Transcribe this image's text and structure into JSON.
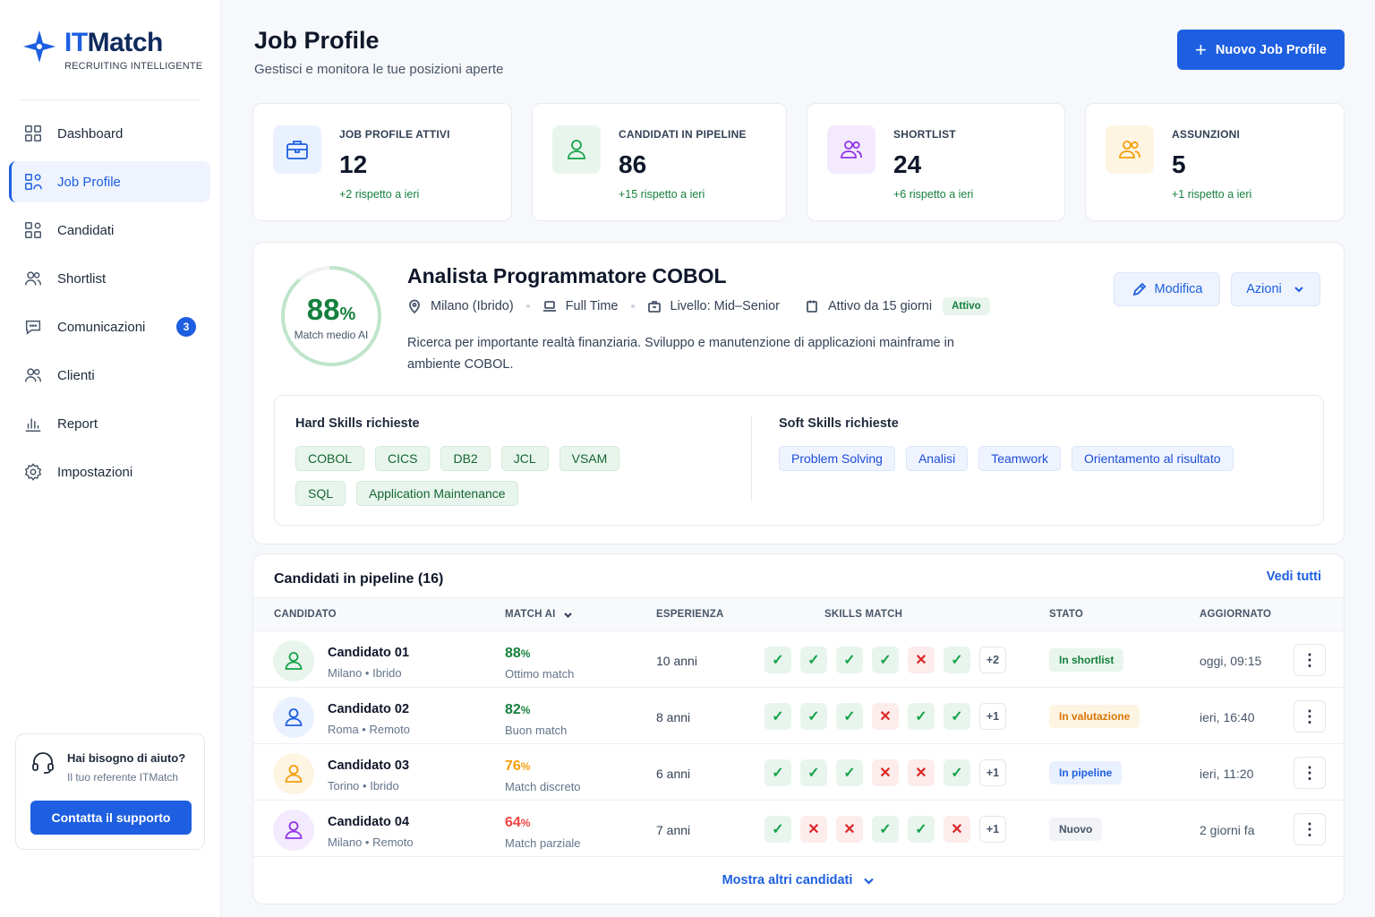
{
  "brand": {
    "name_prefix": "IT",
    "name_suffix": "Match",
    "tagline": "RECRUITING INTELLIGENTE",
    "color": "#1d5fe0"
  },
  "sidebar": {
    "items": [
      {
        "label": "Dashboard",
        "icon": "grid-icon"
      },
      {
        "label": "Job Profile",
        "icon": "job-profile-icon",
        "active": true
      },
      {
        "label": "Candidati",
        "icon": "candidates-icon"
      },
      {
        "label": "Shortlist",
        "icon": "users-icon"
      },
      {
        "label": "Comunicazioni",
        "icon": "chat-icon",
        "badge": "3"
      },
      {
        "label": "Clienti",
        "icon": "clients-icon"
      },
      {
        "label": "Report",
        "icon": "bar-chart-icon"
      },
      {
        "label": "Impostazioni",
        "icon": "gear-icon"
      }
    ],
    "help": {
      "title": "Hai bisogno di aiuto?",
      "subtitle": "Il tuo referente ITMatch",
      "button": "Contatta il supporto"
    }
  },
  "header": {
    "title": "Job Profile",
    "subtitle": "Gestisci e monitora le tue posizioni aperte",
    "new_button": "Nuovo Job Profile"
  },
  "kpis": [
    {
      "label": "JOB PROFILE ATTIVI",
      "value": "12",
      "delta": "+2 rispetto a ieri",
      "icon": "briefcase-icon",
      "color": "#1d5fe0"
    },
    {
      "label": "CANDIDATI IN PIPELINE",
      "value": "86",
      "delta": "+15 rispetto a ieri",
      "icon": "user-icon",
      "color": "#16a34a"
    },
    {
      "label": "SHORTLIST",
      "value": "24",
      "delta": "+6 rispetto a ieri",
      "icon": "users-icon",
      "color": "#9333ea"
    },
    {
      "label": "ASSUNZIONI",
      "value": "5",
      "delta": "+1 rispetto a ieri",
      "icon": "users-icon",
      "color": "#f59e0b"
    }
  ],
  "job": {
    "match": {
      "value": "88",
      "unit": "%",
      "label": "Match medio AI",
      "fraction": 0.88
    },
    "title": "Analista Programmatore COBOL",
    "location": "Milano (Ibrido)",
    "type": "Full Time",
    "level": "Livello: Mid–Senior",
    "active_since": "Attivo da 15 giorni",
    "status": "Attivo",
    "description": "Ricerca per importante realtà finanziaria. Sviluppo e manutenzione di applicazioni mainframe in ambiente COBOL.",
    "edit_button": "Modifica",
    "actions_button": "Azioni",
    "hard_skills_title": "Hard Skills richieste",
    "hard_skills": [
      "COBOL",
      "CICS",
      "DB2",
      "JCL",
      "VSAM",
      "SQL",
      "Application Maintenance"
    ],
    "soft_skills_title": "Soft Skills richieste",
    "soft_skills": [
      "Problem Solving",
      "Analisi",
      "Teamwork",
      "Orientamento al risultato"
    ]
  },
  "pipeline": {
    "title": "Candidati in pipeline (16)",
    "view_all": "Vedi tutti",
    "columns": [
      "CANDIDATO",
      "MATCH AI",
      "ESPERIENZA",
      "SKILLS MATCH",
      "STATO",
      "AGGIORNATO"
    ],
    "rows": [
      {
        "name": "Candidato 01",
        "city": "Milano",
        "mode": "Ibrido",
        "match": "88",
        "match_label": "Ottimo match",
        "experience": "10 anni",
        "skills": [
          "ok",
          "ok",
          "ok",
          "ok",
          "no",
          "ok"
        ],
        "more": "+2",
        "status": "In shortlist",
        "updated": "oggi, 09:15",
        "color": "#16a34a"
      },
      {
        "name": "Candidato 02",
        "city": "Roma",
        "mode": "Remoto",
        "match": "82",
        "match_label": "Buon match",
        "experience": "8 anni",
        "skills": [
          "ok",
          "ok",
          "ok",
          "no",
          "ok",
          "ok"
        ],
        "more": "+1",
        "status": "In valutazione",
        "updated": "ieri, 16:40",
        "color": "#1d5fe0"
      },
      {
        "name": "Candidato 03",
        "city": "Torino",
        "mode": "Ibrido",
        "match": "76",
        "match_label": "Match discreto",
        "experience": "6 anni",
        "skills": [
          "ok",
          "ok",
          "ok",
          "no",
          "no",
          "ok"
        ],
        "more": "+1",
        "status": "In pipeline",
        "updated": "ieri, 11:20",
        "color": "#f59e0b"
      },
      {
        "name": "Candidato 04",
        "city": "Milano",
        "mode": "Remoto",
        "match": "64",
        "match_label": "Match parziale",
        "experience": "7 anni",
        "skills": [
          "ok",
          "no",
          "no",
          "ok",
          "ok",
          "no"
        ],
        "more": "+1",
        "status": "Nuovo",
        "updated": "2 giorni fa",
        "color": "#9333ea"
      }
    ],
    "show_more": "Mostra altri candidati"
  }
}
